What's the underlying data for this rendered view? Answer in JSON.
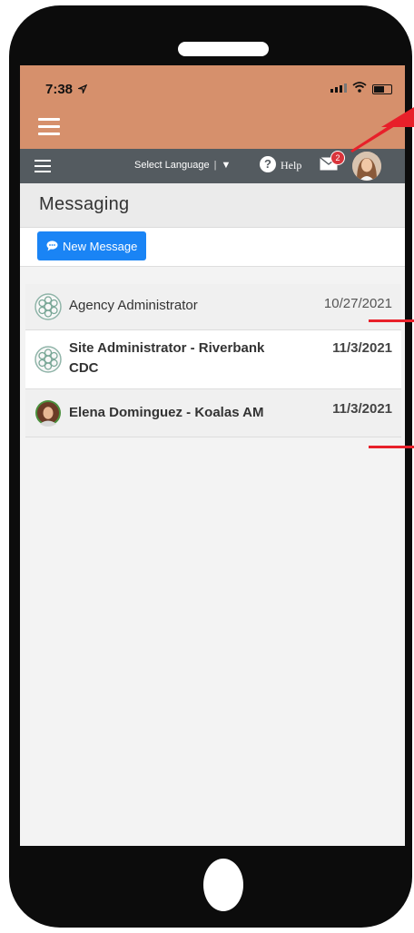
{
  "status_bar": {
    "time": "7:38"
  },
  "nav": {
    "language_select": "Select Language",
    "language_arrow": "▼",
    "help_icon_glyph": "?",
    "help_label": "Help",
    "mail_badge_count": "2"
  },
  "page": {
    "title": "Messaging",
    "new_message_button": "New Message"
  },
  "messages": [
    {
      "name": "Agency Administrator",
      "date": "10/27/2021",
      "unread": false
    },
    {
      "name_line1": "Site Administrator - Riverbank",
      "name_line2": "CDC",
      "date": "11/3/2021",
      "unread": true
    },
    {
      "name": "Elena Dominguez - Koalas AM",
      "date": "11/3/2021",
      "unread": true
    }
  ],
  "colors": {
    "status_bar_bg": "#d6906c",
    "navbar_bg": "#545b60",
    "button_blue": "#1a84f5",
    "badge_red": "#d9343b",
    "annotation_red": "#e8202a"
  },
  "icons": [
    "hamburger-menu-icon",
    "location-arrow-icon",
    "signal-icon",
    "wifi-icon",
    "battery-icon",
    "help-icon",
    "mail-icon",
    "chat-bubble-icon",
    "agency-logo-icon",
    "user-avatar"
  ]
}
